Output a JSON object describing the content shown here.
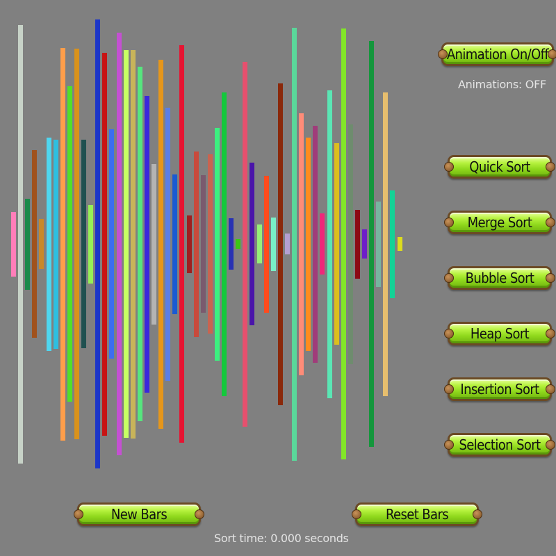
{
  "buttons": {
    "animation_toggle": "Animation On/Off",
    "quick_sort": "Quick Sort",
    "merge_sort": "Merge Sort",
    "bubble_sort": "Bubble Sort",
    "heap_sort": "Heap Sort",
    "insertion_sort": "Insertion Sort",
    "selection_sort": "Selection Sort",
    "new_bars": "New Bars",
    "reset_bars": "Reset Bars"
  },
  "status": {
    "animations": "Animations: OFF",
    "sort_time": "Sort time: 0.000 seconds"
  },
  "colors": {
    "background": "#808080",
    "button_green": "#a6e628",
    "button_border": "#6b4a25",
    "label_text": "#e4e4e4"
  },
  "bars": [
    {
      "value": 93,
      "color": "#ff7eb9"
    },
    {
      "value": 631,
      "color": "#c7d2c7"
    },
    {
      "value": 131,
      "color": "#1a8a4a"
    },
    {
      "value": 270,
      "color": "#a0521d"
    },
    {
      "value": 72,
      "color": "#c8882a"
    },
    {
      "value": 307,
      "color": "#4fd6f0"
    },
    {
      "value": 301,
      "color": "#2ebfe0"
    },
    {
      "value": 565,
      "color": "#ff9e4a"
    },
    {
      "value": 454,
      "color": "#52e028"
    },
    {
      "value": 562,
      "color": "#d9921c"
    },
    {
      "value": 300,
      "color": "#1f5050"
    },
    {
      "value": 113,
      "color": "#96f056"
    },
    {
      "value": 646,
      "color": "#1c36c8"
    },
    {
      "value": 551,
      "color": "#c81414"
    },
    {
      "value": 330,
      "color": "#3c6ef0"
    },
    {
      "value": 608,
      "color": "#c450d2"
    },
    {
      "value": 558,
      "color": "#c8ff64"
    },
    {
      "value": 559,
      "color": "#c8b45a"
    },
    {
      "value": 510,
      "color": "#56e67e"
    },
    {
      "value": 427,
      "color": "#3a28dc"
    },
    {
      "value": 231,
      "color": "#b4b4b4"
    },
    {
      "value": 531,
      "color": "#e6961a"
    },
    {
      "value": 393,
      "color": "#5a7ee6"
    },
    {
      "value": 201,
      "color": "#1a5ad2"
    },
    {
      "value": 572,
      "color": "#e61432"
    },
    {
      "value": 83,
      "color": "#a01e1e"
    },
    {
      "value": 267,
      "color": "#c84a3c"
    },
    {
      "value": 198,
      "color": "#7a5a6e"
    },
    {
      "value": 258,
      "color": "#c86450"
    },
    {
      "value": 335,
      "color": "#3cf080"
    },
    {
      "value": 437,
      "color": "#14c83c"
    },
    {
      "value": 74,
      "color": "#2832b4"
    },
    {
      "value": 14,
      "color": "#3cc814"
    },
    {
      "value": 525,
      "color": "#e6506e"
    },
    {
      "value": 234,
      "color": "#4a14aa"
    },
    {
      "value": 56,
      "color": "#96f078"
    },
    {
      "value": 197,
      "color": "#ff4b1e"
    },
    {
      "value": 77,
      "color": "#78f0c8"
    },
    {
      "value": 463,
      "color": "#8a280a"
    },
    {
      "value": 30,
      "color": "#b4a0d2"
    },
    {
      "value": 623,
      "color": "#5ad79a"
    },
    {
      "value": 377,
      "color": "#ff8c78"
    },
    {
      "value": 307,
      "color": "#ff8c1e"
    },
    {
      "value": 341,
      "color": "#a03c7a"
    },
    {
      "value": 88,
      "color": "#f0287a"
    },
    {
      "value": 443,
      "color": "#5ae6b4"
    },
    {
      "value": 290,
      "color": "#dcbe1e"
    },
    {
      "value": 620,
      "color": "#82e628"
    },
    {
      "value": 345,
      "color": "#6e8c6e"
    },
    {
      "value": 99,
      "color": "#8c0a14"
    },
    {
      "value": 42,
      "color": "#6e1ec8"
    },
    {
      "value": 584,
      "color": "#14963c"
    },
    {
      "value": 123,
      "color": "#78b4a0"
    },
    {
      "value": 437,
      "color": "#e6be6e"
    },
    {
      "value": 155,
      "color": "#14d296"
    },
    {
      "value": 20,
      "color": "#dcdc1e"
    }
  ]
}
